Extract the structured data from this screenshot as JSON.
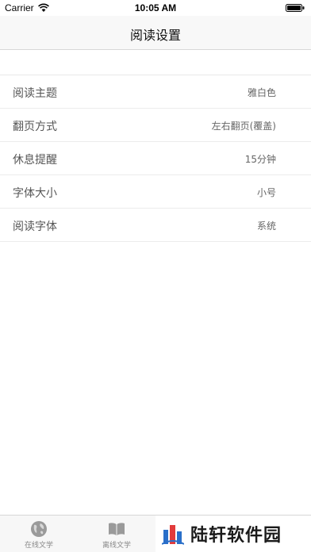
{
  "status_bar": {
    "carrier": "Carrier",
    "time": "10:05 AM"
  },
  "nav": {
    "title": "阅读设置"
  },
  "settings": [
    {
      "label": "阅读主题",
      "value": "雅白色"
    },
    {
      "label": "翻页方式",
      "value": "左右翻页(覆盖)"
    },
    {
      "label": "休息提醒",
      "value": "15分钟"
    },
    {
      "label": "字体大小",
      "value": "小号"
    },
    {
      "label": "阅读字体",
      "value": "系统"
    }
  ],
  "tabs": [
    {
      "label": "在线文学",
      "icon": "globe-icon"
    },
    {
      "label": "离线文学",
      "icon": "book-icon"
    }
  ],
  "watermark": {
    "text": "陆轩软件园"
  },
  "colors": {
    "nav_background": "#f8f8f8",
    "separator": "#ececec",
    "tab_bar_background": "#f7f7f7"
  }
}
